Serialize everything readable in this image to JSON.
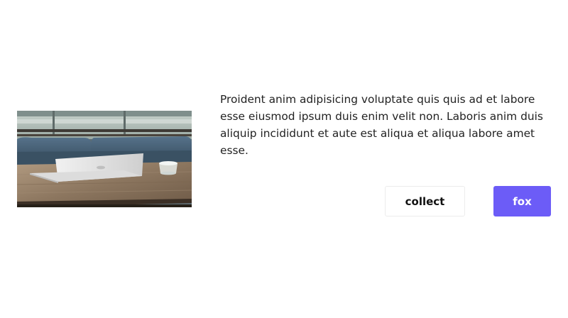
{
  "card": {
    "image": {
      "description_icon": "laptop-on-table-photo",
      "colors": {
        "sofa": "#44617a",
        "table": "#8a7561",
        "laptop": "#e8e8e8",
        "background": "#a9b7b3"
      }
    },
    "description": "Proident anim adipisicing voluptate quis quis ad et labore esse eiusmod ipsum duis enim velit non. Laboris anim duis aliquip incididunt et aute est aliqua et aliqua labore amet esse.",
    "actions": {
      "collect_label": "collect",
      "fox_label": "fox"
    },
    "colors": {
      "primary": "#6c5cf7",
      "text": "#222222",
      "border": "#ececec"
    }
  }
}
